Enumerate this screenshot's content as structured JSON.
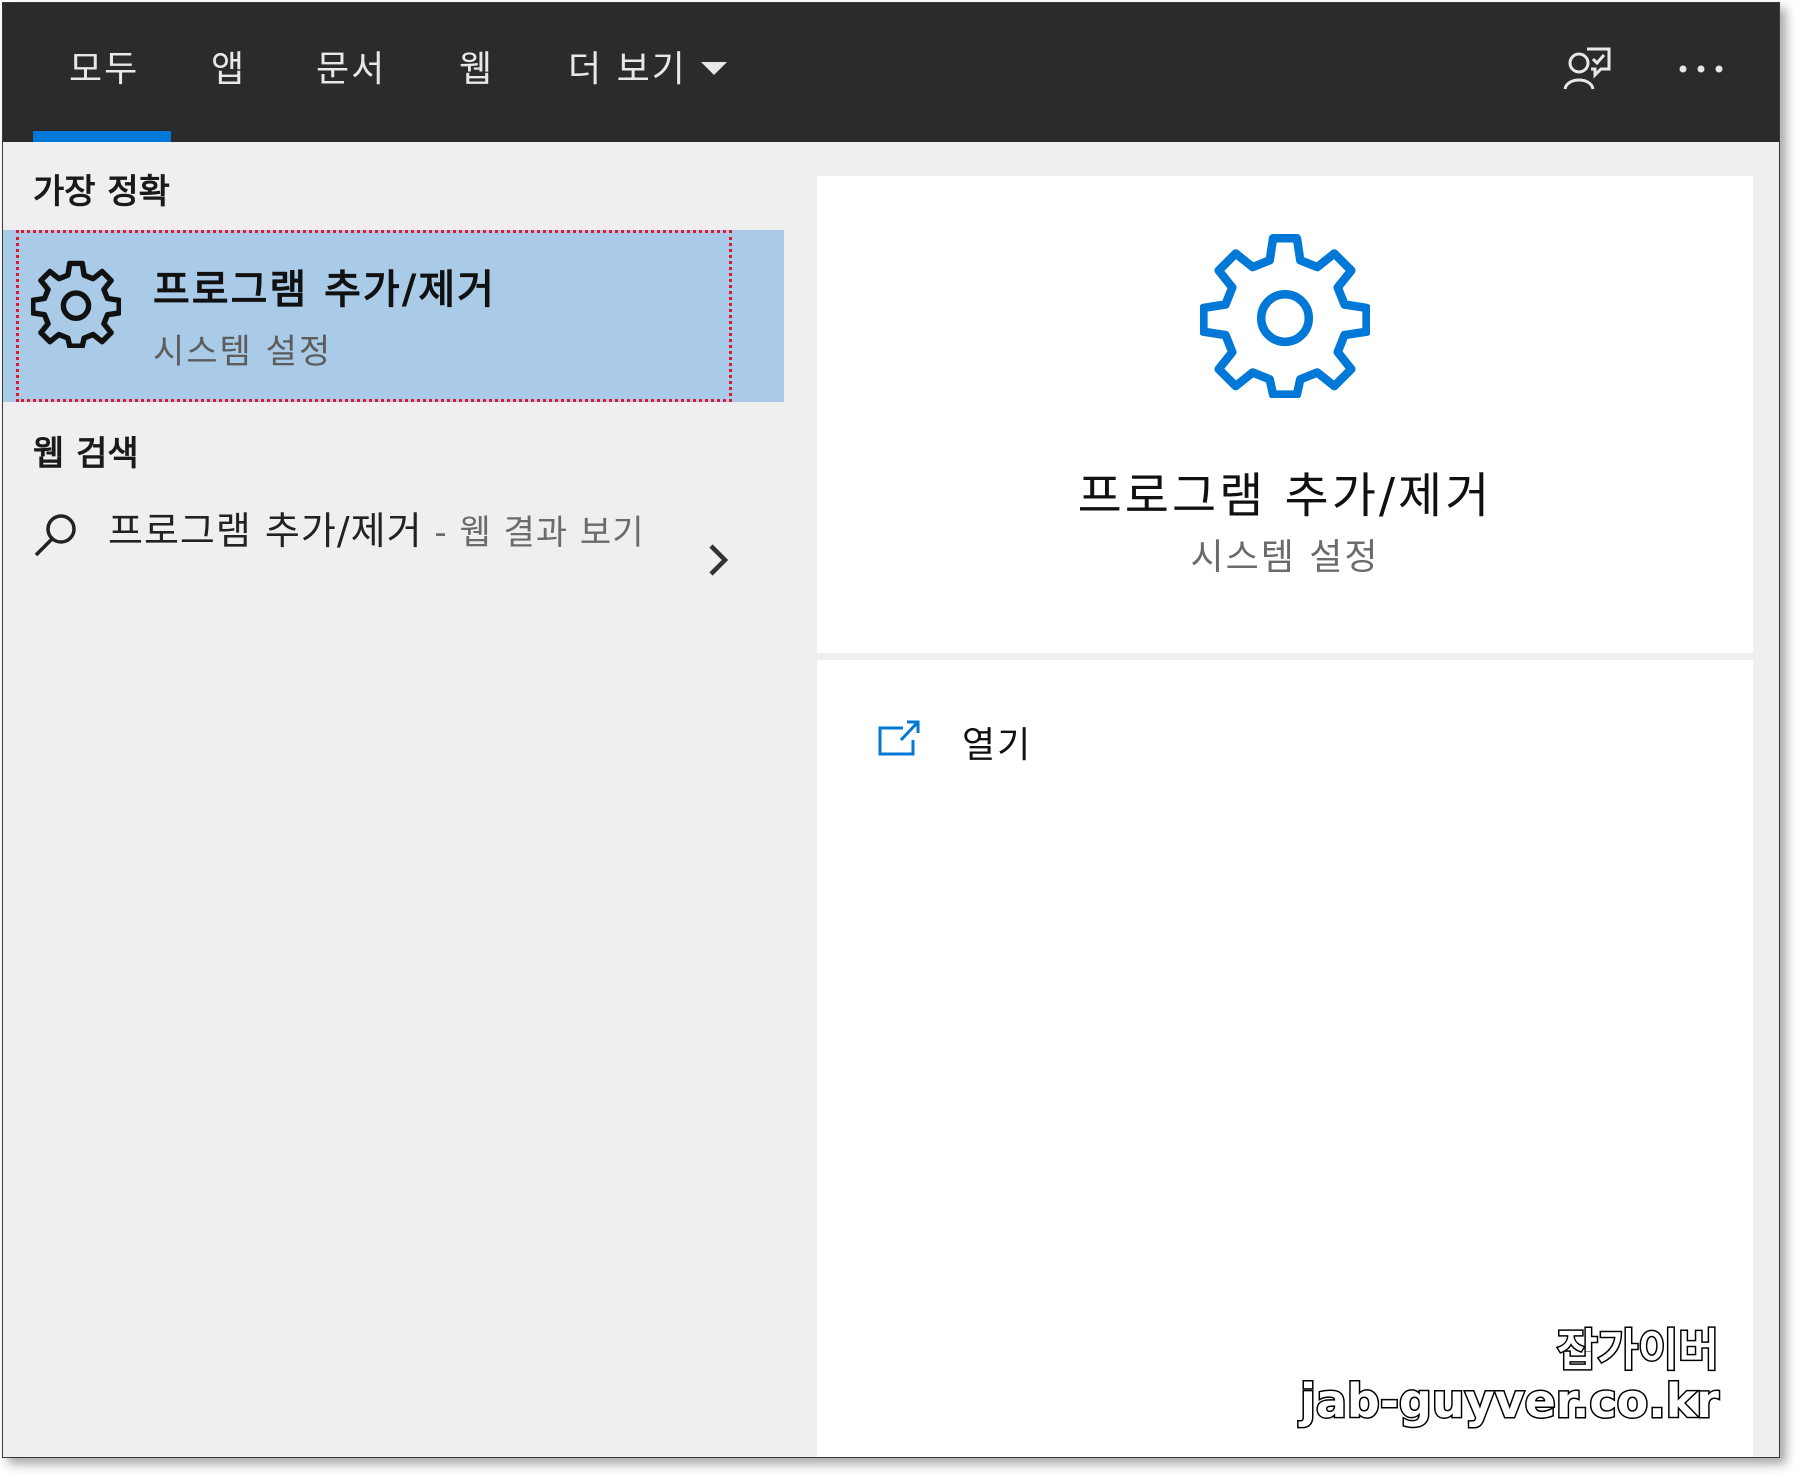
{
  "topbar": {
    "tabs": [
      {
        "label": "모두"
      },
      {
        "label": "앱"
      },
      {
        "label": "문서"
      },
      {
        "label": "웹"
      },
      {
        "label": "더 보기"
      }
    ],
    "feedback_icon": "feedback-person-icon",
    "more_icon": "ellipsis-icon"
  },
  "left": {
    "best_match_header": "가장 정확",
    "best_match": {
      "icon": "gear-icon",
      "title": "프로그램 추가/제거",
      "subtitle": "시스템 설정"
    },
    "web_search_header": "웹 검색",
    "web_result": {
      "icon": "search-icon",
      "query": "프로그램 추가/제거",
      "suffix": " - 웹 결과 보기",
      "chevron": "chevron-right-icon"
    }
  },
  "right": {
    "icon": "gear-icon",
    "title": "프로그램 추가/제거",
    "subtitle": "시스템 설정",
    "actions": [
      {
        "icon": "open-external-icon",
        "label": "열기"
      }
    ]
  },
  "watermark": {
    "line1": "잡가이버",
    "line2": "jab-guyver.co.kr"
  },
  "colors": {
    "accent": "#0078d7",
    "topbar": "#2b2b2b",
    "selection": "#aacbe8",
    "highlight_border": "#e0182d"
  }
}
